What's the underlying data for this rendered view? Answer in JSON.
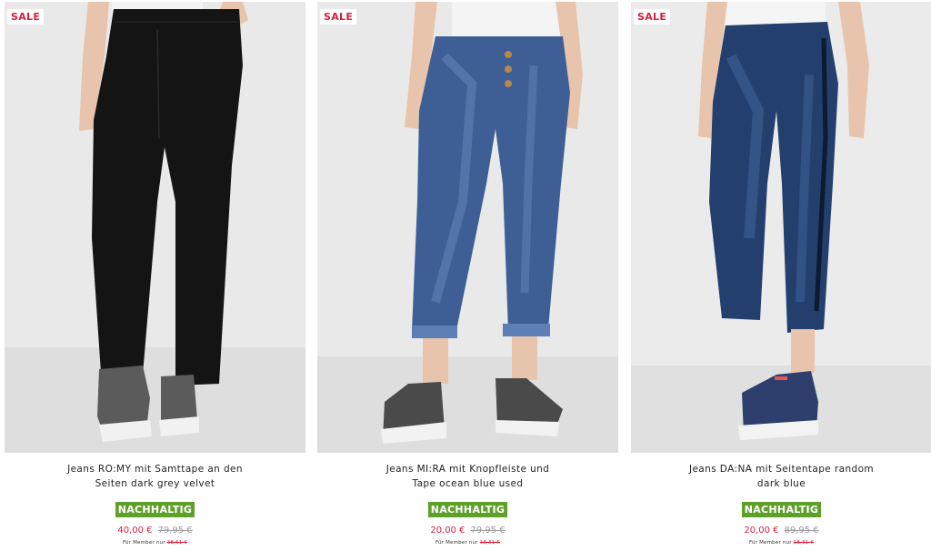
{
  "products": [
    {
      "badge": "SALE",
      "title_line1": "Jeans RO:MY mit Samttape an den",
      "title_line2": "Seiten dark grey velvet",
      "sustainable": "NACHHALTIG",
      "price": "40,00 €",
      "old_price": "79,95 €",
      "member_label": "Für Member nur",
      "member_price": "38,61 €"
    },
    {
      "badge": "SALE",
      "title_line1": "Jeans MI:RA mit Knopfleiste und",
      "title_line2": "Tape ocean blue used",
      "sustainable": "NACHHALTIG",
      "price": "20,00 €",
      "old_price": "79,95 €",
      "member_label": "Für Member nur",
      "member_price": "18,31 €"
    },
    {
      "badge": "SALE",
      "title_line1": "Jeans DA:NA mit Seitentape random",
      "title_line2": "dark blue",
      "sustainable": "NACHHALTIG",
      "price": "20,00 €",
      "old_price": "89,95 €",
      "member_label": "Für Member nur",
      "member_price": "18,31 €"
    }
  ],
  "colors": {
    "sale_red": "#d61f3c",
    "sustainable_green": "#5ea02a",
    "photo_background": "#e8e8e8"
  }
}
